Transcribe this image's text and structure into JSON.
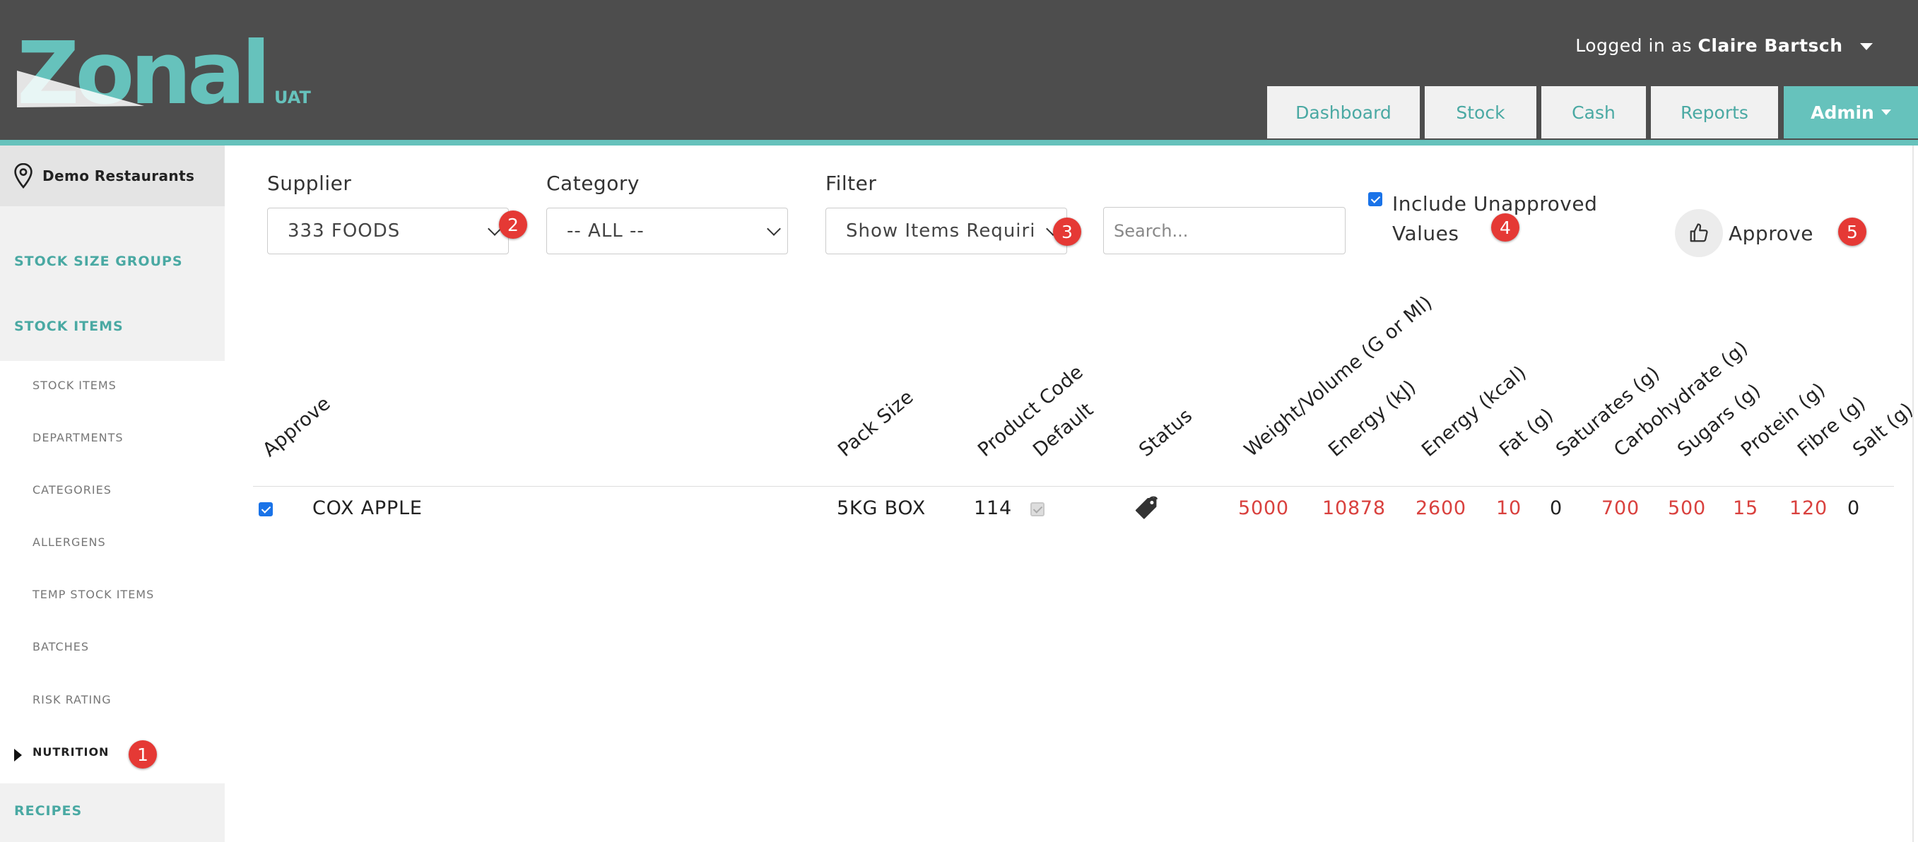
{
  "header": {
    "logo_text": "Zonal",
    "env_label": "UAT",
    "login_prefix": "Logged in as",
    "user_name": "Claire Bartsch",
    "nav": [
      {
        "label": "Dashboard"
      },
      {
        "label": "Stock"
      },
      {
        "label": "Cash"
      },
      {
        "label": "Reports"
      },
      {
        "label": "Admin",
        "active": true
      }
    ]
  },
  "sidebar": {
    "site_name": "Demo Restaurants",
    "sections": [
      {
        "label": "STOCK SIZE GROUPS"
      },
      {
        "label": "STOCK ITEMS"
      },
      {
        "label": "RECIPES"
      }
    ],
    "stock_items_sub": [
      {
        "label": "STOCK ITEMS"
      },
      {
        "label": "DEPARTMENTS"
      },
      {
        "label": "CATEGORIES"
      },
      {
        "label": "ALLERGENS"
      },
      {
        "label": "TEMP STOCK ITEMS"
      },
      {
        "label": "BATCHES"
      },
      {
        "label": "RISK RATING"
      },
      {
        "label": "NUTRITION",
        "active": true
      }
    ]
  },
  "filters": {
    "supplier": {
      "label": "Supplier",
      "value": "333 FOODS"
    },
    "category": {
      "label": "Category",
      "value": "-- ALL --"
    },
    "filter": {
      "label": "Filter",
      "value": "Show Items Requiri"
    },
    "search": {
      "placeholder": "Search..."
    },
    "include_unapproved": {
      "label": "Include Unapproved Values",
      "checked": true
    },
    "approve_button": {
      "label": "Approve"
    }
  },
  "badges": [
    "1",
    "2",
    "3",
    "4",
    "5"
  ],
  "table": {
    "headers": [
      "Approve",
      "Pack Size",
      "Product Code",
      "Default",
      "Status",
      "Weight/Volume (G or Ml)",
      "Energy (kJ)",
      "Energy (kcal)",
      "Fat (g)",
      "Saturates (g)",
      "Carbohydrate (g)",
      "Sugars (g)",
      "Protein (g)",
      "Fibre (g)",
      "Salt (g)"
    ],
    "rows": [
      {
        "approve": true,
        "name": "COX APPLE",
        "pack_size": "5KG BOX",
        "product_code": "114",
        "default": true,
        "status_icon": "tag-icon",
        "weight_volume": "5000",
        "energy_kj": "10878",
        "energy_kcal": "2600",
        "fat": "10",
        "saturates": "0",
        "carbohydrate": "700",
        "sugars": "500",
        "protein": "15",
        "fibre": "120",
        "salt": "0"
      }
    ]
  },
  "colors": {
    "header_bg": "#4d4d4d",
    "accent_teal": "#66c2bc",
    "value_red": "#d9413e",
    "badge_red": "#e53935"
  }
}
